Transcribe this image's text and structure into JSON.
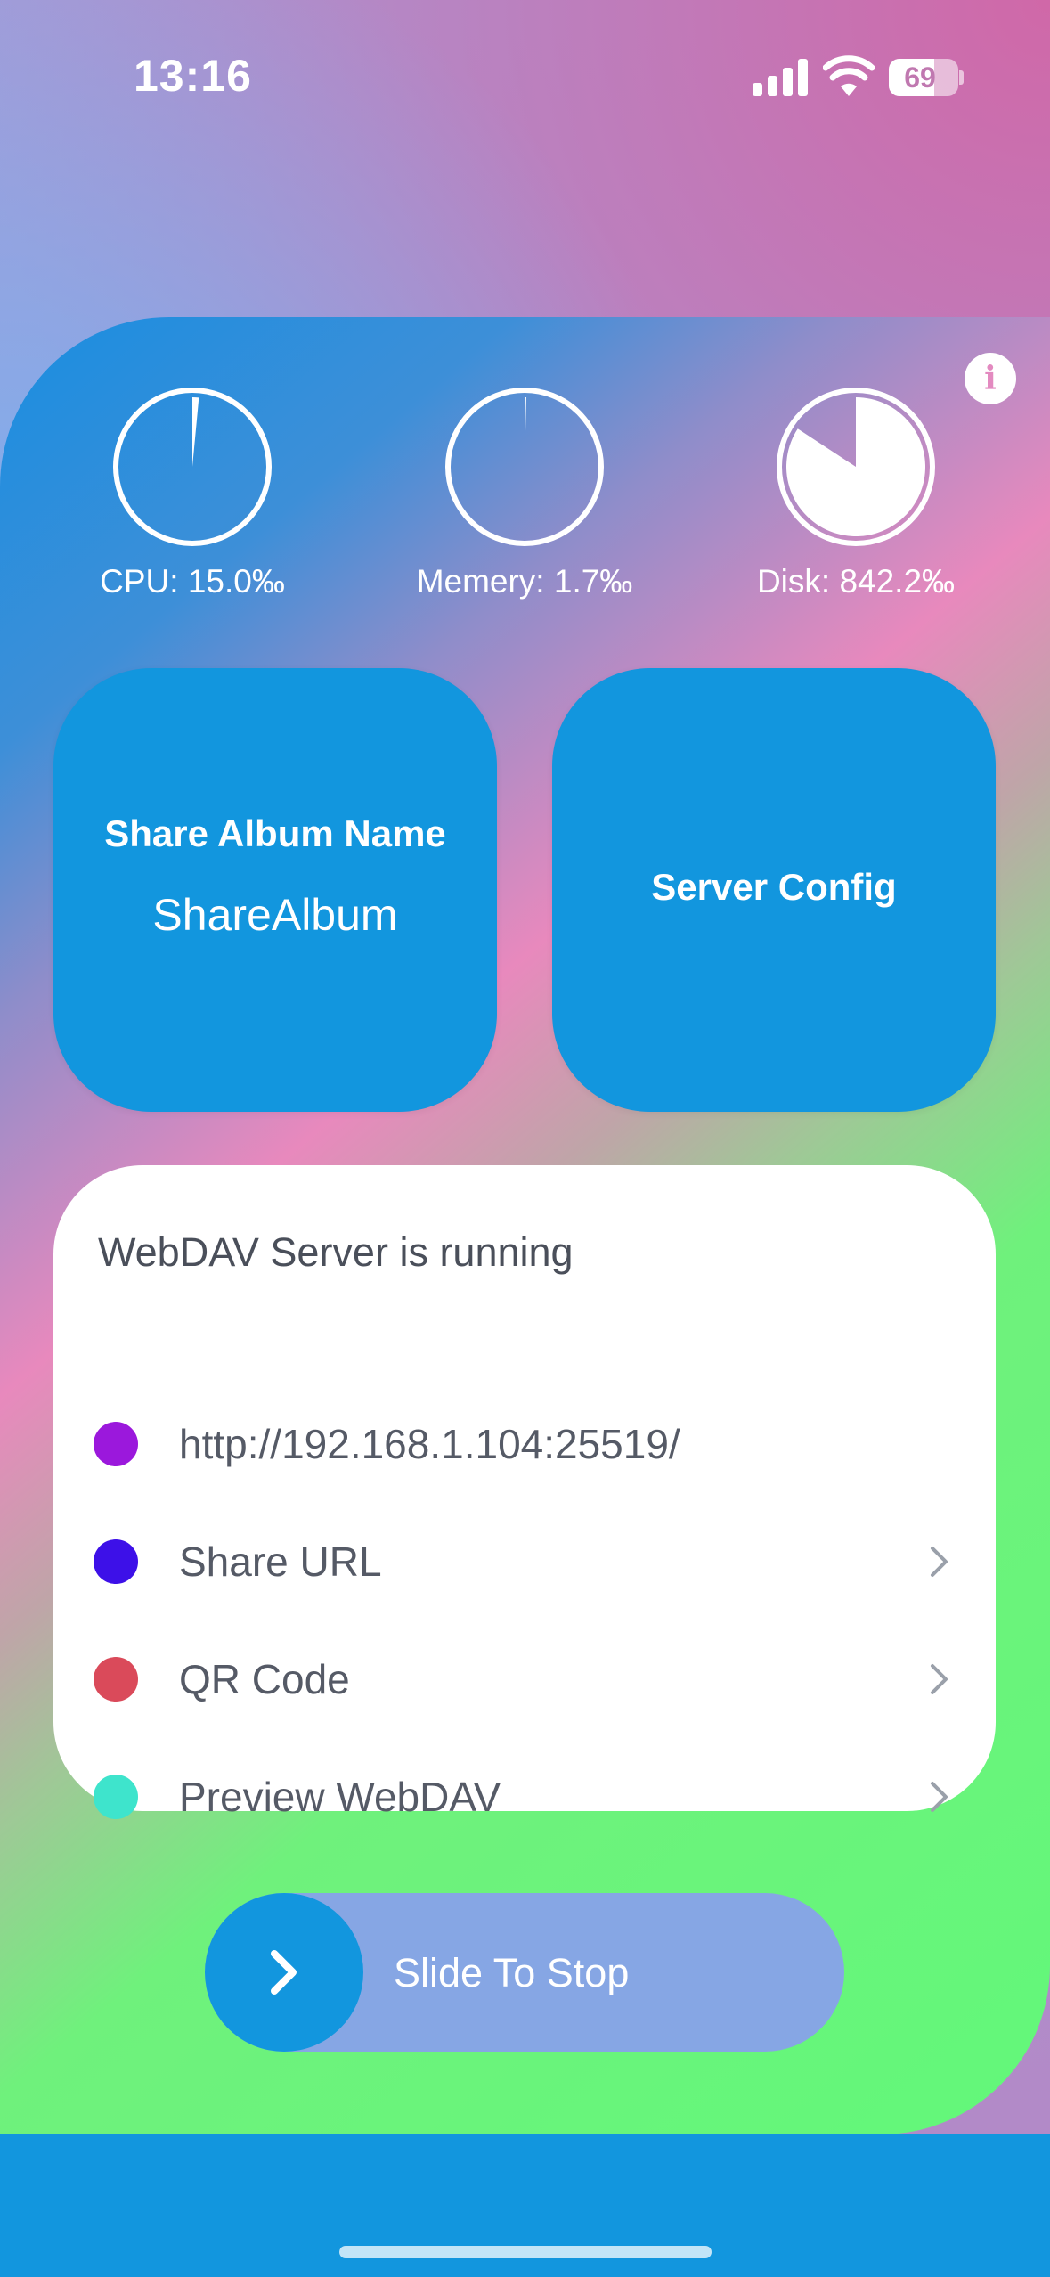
{
  "status_bar": {
    "time": "13:16",
    "battery": "69"
  },
  "gauges": [
    {
      "label": "CPU: 15.0‰",
      "value_permille": 15.0
    },
    {
      "label": "Memery: 1.7‰",
      "value_permille": 1.7
    },
    {
      "label": "Disk: 842.2‰",
      "value_permille": 842.2
    }
  ],
  "tiles": {
    "share_album": {
      "title": "Share Album Name",
      "value": "ShareAlbum"
    },
    "server_config": {
      "title": "Server Config"
    }
  },
  "server_panel": {
    "status": "WebDAV Server is running",
    "rows": [
      {
        "label": "http://192.168.1.104:25519/",
        "color": "#9b18dc",
        "chevron": false
      },
      {
        "label": "Share URL",
        "color": "#3d10e8",
        "chevron": true
      },
      {
        "label": "QR Code",
        "color": "#da4a5a",
        "chevron": true
      },
      {
        "label": "Preview WebDAV",
        "color": "#3ee4cc",
        "chevron": true
      }
    ]
  },
  "slider": {
    "label": "Slide To Stop"
  },
  "colors": {
    "tile_blue": "#1296de",
    "slider_track": "#86a6e4"
  }
}
